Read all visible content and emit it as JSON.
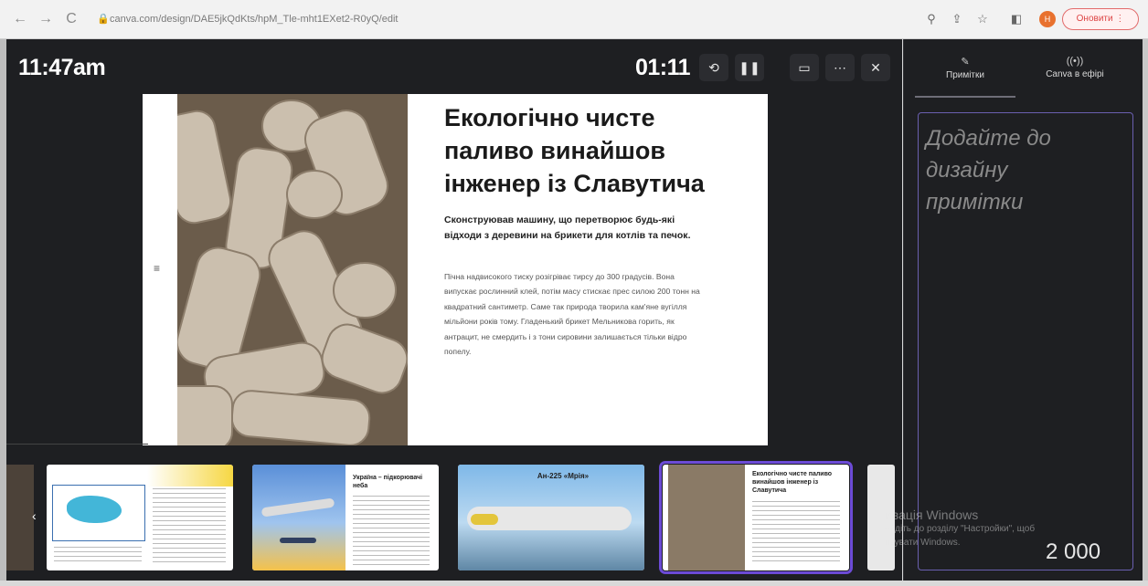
{
  "browser": {
    "url": "canva.com/design/DAE5jkQdKts/hpM_Tle-mht1EXet2-R0yQ/edit",
    "update_button": "Оновити",
    "avatar_letter": "H"
  },
  "presenter": {
    "clock": "11:47am",
    "timer": "01:11"
  },
  "slide": {
    "title": "Екологічно чисте паливо винайшов інженер із Славутича",
    "subtitle": "Сконструював машину, що перетворює будь-які відходи з деревини на брикети для котлів та печок.",
    "body": "Пічна надвисокого тиску розігріває тирсу до 300 градусів. Вона випускає рослинний клей, потім масу стискає прес силою 200 тонн на квадратний сантиметр. Саме так природа творила кам'яне вугілля мільйони років тому. Гладенький брикет Мельникова горить, як антрацит, не смердить і з тони сировини залишається тільки відро попелу."
  },
  "thumbnails": [
    {
      "title": "",
      "type": "map"
    },
    {
      "title": "Україна – підкорювачі неба",
      "type": "plane"
    },
    {
      "title": "Ан-225 «Мрія»",
      "type": "mriya"
    },
    {
      "title": "Екологічно чисте паливо винайшов інженер із Славутича",
      "type": "briquettes",
      "active": true
    }
  ],
  "sidebar": {
    "tab_notes": "Примітки",
    "tab_live": "Canva в ефірі",
    "notes_placeholder": "Додайте до дизайну примітки",
    "char_count": "2 000"
  },
  "watermark": {
    "line1": "ивація Windows",
    "line2": "ейдіть до розділу \"Настройки\", щоб",
    "line3": "ивувати Windows."
  }
}
